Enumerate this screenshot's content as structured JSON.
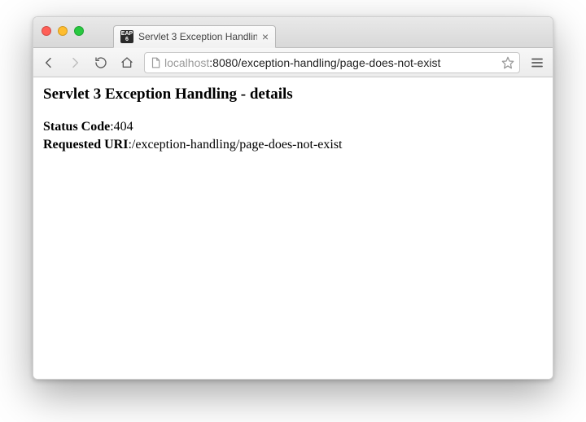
{
  "tab": {
    "title": "Servlet 3 Exception Handlin",
    "favicon_text": "EAP\n6"
  },
  "url": {
    "host": "localhost",
    "port_and_path": ":8080/exception-handling/page-does-not-exist"
  },
  "page": {
    "heading": "Servlet 3 Exception Handling - details",
    "status_label": "Status Code",
    "status_value": ":404",
    "uri_label": "Requested URI",
    "uri_value": ":/exception-handling/page-does-not-exist"
  }
}
